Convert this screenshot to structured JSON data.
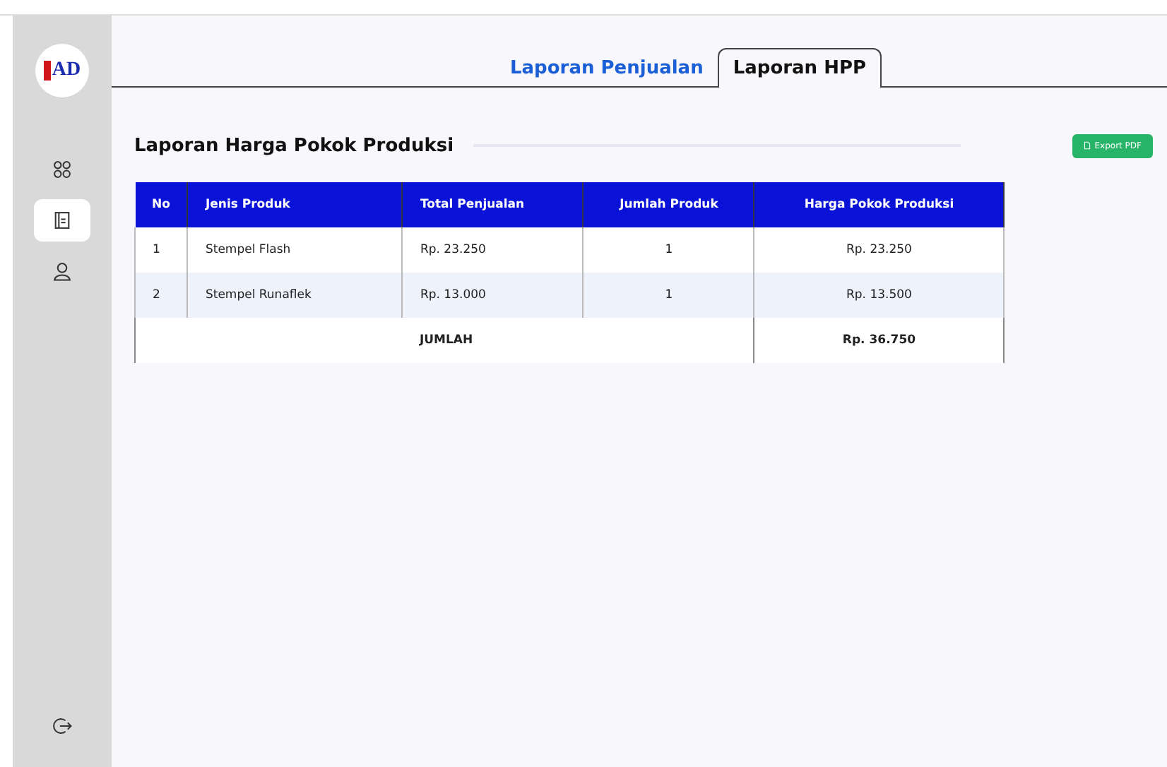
{
  "logo": {
    "text": "AD"
  },
  "sidebar": {
    "items": [
      {
        "kind": "apps",
        "selected": false
      },
      {
        "kind": "report",
        "selected": true
      },
      {
        "kind": "user",
        "selected": false
      }
    ]
  },
  "tabs": [
    {
      "label": "Laporan Penjualan",
      "selected": false
    },
    {
      "label": "Laporan HPP",
      "selected": true
    }
  ],
  "section_title": "Laporan Harga Pokok Produksi",
  "export_button": "Export PDF",
  "table": {
    "columns": [
      "No",
      "Jenis Produk",
      "Total Penjualan",
      "Jumlah Produk",
      "Harga Pokok Produksi"
    ],
    "rows": [
      [
        "1",
        "Stempel Flash",
        "Rp. 23.250",
        "1",
        "Rp. 23.250"
      ],
      [
        "2",
        "Stempel Runaflek",
        "Rp. 13.000",
        "1",
        "Rp. 13.500"
      ]
    ],
    "total": {
      "label": "JUMLAH",
      "value": "Rp. 36.750"
    }
  }
}
